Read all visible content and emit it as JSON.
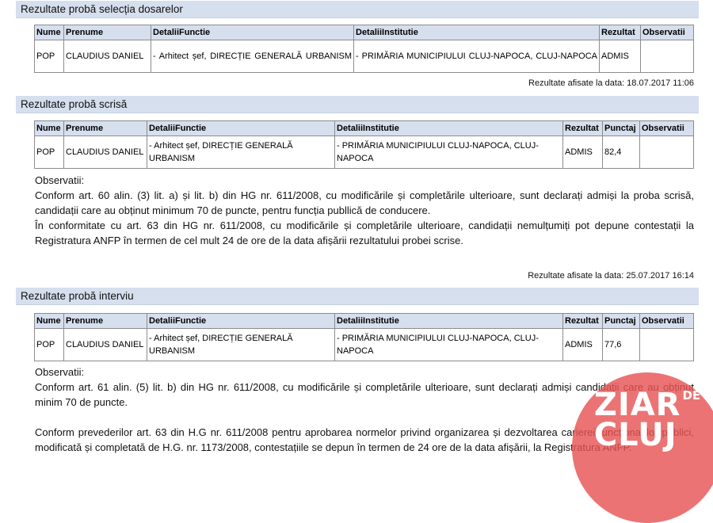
{
  "section1": {
    "title": "Rezultate probă selecția dosarelor",
    "headers": [
      "Nume",
      "Prenume",
      "DetaliiFunctie",
      "DetaliiInstitutie",
      "Rezultat",
      "Observatii"
    ],
    "row": {
      "nume": "POP",
      "prenume": "CLAUDIUS DANIEL",
      "functie": "- Arhitect șef, DIRECȚIE GENERALĂ URBANISM",
      "institutie": "- PRIMĂRIA MUNICIPIULUI CLUJ-NAPOCA, CLUJ-NAPOCA",
      "rezultat": "ADMIS",
      "observatii": ""
    },
    "posted": "Rezultate afisate la data: 18.07.2017 11:06"
  },
  "section2": {
    "title": "Rezultate probă scrisă",
    "headers": [
      "Nume",
      "Prenume",
      "DetaliiFunctie",
      "DetaliiInstitutie",
      "Rezultat",
      "Punctaj",
      "Observatii"
    ],
    "row": {
      "nume": "POP",
      "prenume": "CLAUDIUS DANIEL",
      "functie": "- Arhitect șef, DIRECȚIE GENERALĂ URBANISM",
      "institutie": "- PRIMĂRIA MUNICIPIULUI CLUJ-NAPOCA, CLUJ-NAPOCA",
      "rezultat": "ADMIS",
      "punctaj": "82,4",
      "observatii": ""
    },
    "obs_label": "Observatii:",
    "obs_p1": "Conform art. 60 alin. (3) lit. a) și lit. b) din HG nr. 611/2008, cu modificările și completările ulterioare, sunt declarați admiși la proba scrisă, candidații care au obținut minimum 70 de puncte, pentru funcția publlică de conducere.",
    "obs_p2": "În conformitate cu art. 63 din HG nr. 611/2008, cu modificările și completările ulterioare, candidații nemulțumiți pot depune contestații la Registratura ANFP în termen de cel mult 24 de ore de la data afișării rezultatului probei scrise.",
    "posted": "Rezultate afisate la data: 25.07.2017 16:14"
  },
  "section3": {
    "title": "Rezultate probă interviu",
    "headers": [
      "Nume",
      "Prenume",
      "DetaliiFunctie",
      "DetaliiInstitutie",
      "Rezultat",
      "Punctaj",
      "Observatii"
    ],
    "row": {
      "nume": "POP",
      "prenume": "CLAUDIUS DANIEL",
      "functie": "- Arhitect șef, DIRECȚIE GENERALĂ URBANISM",
      "institutie": "- PRIMĂRIA MUNICIPIULUI CLUJ-NAPOCA, CLUJ-NAPOCA",
      "rezultat": "ADMIS",
      "punctaj": "77,6",
      "observatii": ""
    },
    "obs_label": "Observatii:",
    "obs_p1": "Conform art. 61 alin. (5) lit. b) din HG nr. 611/2008, cu modificările și completările ulterioare, sunt declarați admiși candidații care au obținut minim 70 de puncte.",
    "obs_p2": "Conform prevederilor art. 63 din H.G nr. 611/2008 pentru aprobarea normelor privind organizarea și dezvoltarea carierei funcționarilor publici, modificată și completată de H.G. nr. 1173/2008, contestațiile se depun în termen de 24 ore de la data afișării, la Registratura ANFP."
  },
  "watermark": {
    "line1": "ZIAR",
    "line1_small": "DE",
    "line2": "CLUJ",
    "color": "#e85454"
  }
}
